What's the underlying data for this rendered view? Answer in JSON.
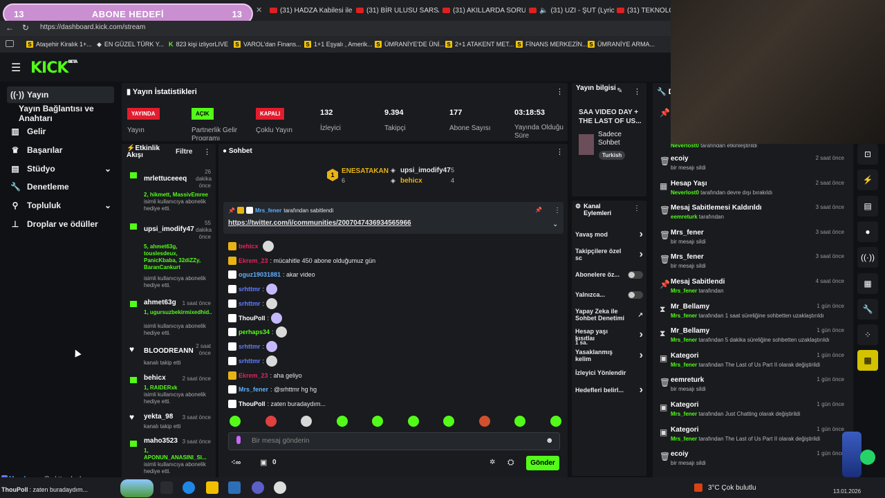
{
  "overlay": {
    "goal_left": "13",
    "goal_title": "ABONE HEDEFİ",
    "goal_right": "13"
  },
  "tabs": [
    {
      "label": "(31) HADZA Kabilesi ile H"
    },
    {
      "label": "(31) BİR ULUSU SARSAN"
    },
    {
      "label": "(31) AKILLARDA SORU İ"
    },
    {
      "label": "(31) UZI - ŞUT (Lyric"
    },
    {
      "label": "(31) TEKNOLOJİNİ"
    }
  ],
  "url": "https://dashboard.kick.com/stream",
  "bookmarks": [
    {
      "label": "Ataşehir Kiralık 1+..."
    },
    {
      "label": "EN GÜZEL TÜRK Y..."
    },
    {
      "label": "823 kişi izliyorLIVE"
    },
    {
      "label": "VAROL'dan Finans..."
    },
    {
      "label": "1+1 Eşyalı , Amerik..."
    },
    {
      "label": "ÜMRANİYE'DE ÜNİ..."
    },
    {
      "label": "2+1 ATAKENT MET..."
    },
    {
      "label": "FİNANS MERKEZİN..."
    },
    {
      "label": "ÜMRANİYE ARMA..."
    }
  ],
  "brand": {
    "logo": "KICK",
    "beta": "BETA"
  },
  "sidebar": [
    {
      "label": "Yayın",
      "icon": "broadcast-icon"
    },
    {
      "label": "Yayın Bağlantısı ve Anahtarı",
      "icon": ""
    },
    {
      "label": "Gelir",
      "icon": "chart-icon"
    },
    {
      "label": "Başarılar",
      "icon": "trophy-icon"
    },
    {
      "label": "Stüdyo",
      "icon": "studio-icon"
    },
    {
      "label": "Denetleme",
      "icon": "wrench-icon"
    },
    {
      "label": "Topluluk",
      "icon": "community-icon"
    },
    {
      "label": "Droplar ve ödüller",
      "icon": "drops-icon"
    }
  ],
  "stats": {
    "title": "Yayın İstatistikleri",
    "items": [
      {
        "badge": "YAYINDA",
        "label": "Yayın"
      },
      {
        "badge": "AÇIK",
        "label": "Partnerlik Gelir Programı"
      },
      {
        "badge": "KAPALI",
        "label": "Çoklu Yayın"
      },
      {
        "value": "132",
        "label": "İzleyici"
      },
      {
        "value": "9.394",
        "label": "Takipçi"
      },
      {
        "value": "177",
        "label": "Abone Sayısı"
      },
      {
        "value": "03:18:53",
        "label": "Yayında Olduğu Süre"
      }
    ]
  },
  "activity": {
    "title": "Etkinlik Akışı",
    "filter": "Filtre",
    "items": [
      {
        "name": "mrlettuceeeq",
        "time": "26 dakika önce",
        "green": "2, hikmett, MassivEmree",
        "desc": "isimli kullanıcıya abonelik hediye etti."
      },
      {
        "name": "upsi_imodify47",
        "time": "55 dakika önce",
        "green": "5, ahmet63g, touslesdeux, PanicKbaba, 32diZZy, BaranCankurt",
        "desc": "isimli kullanıcıya abonelik hediye etti."
      },
      {
        "name": "ahmet63g",
        "time": "1 saat önce",
        "green": "1, ugursuzbekirmixedhid...",
        "desc": "isimli kullanıcıya abonelik hediye etti."
      },
      {
        "name": "BLOODREANN",
        "time": "2 saat önce",
        "green": "",
        "desc": "kanalı takip etti"
      },
      {
        "name": "behicx",
        "time": "2 saat önce",
        "green": "1, RAIDERxk",
        "desc": "isimli kullanıcıya abonelik hediye etti."
      },
      {
        "name": "yekta_98",
        "time": "3 saat önce",
        "green": "",
        "desc": "kanalı takip etti"
      },
      {
        "name": "maho3523",
        "time": "3 saat önce",
        "green": "1, APONUN_ANASINI_SI...",
        "desc": "isimli kullanıcıya abonelik hediye etti."
      }
    ]
  },
  "chat": {
    "title": "Sohbet",
    "leaders": [
      {
        "name": "ENESATAKAN",
        "count": "6",
        "rank": "1"
      },
      {
        "name": "upsi_imodify47",
        "count": "5"
      },
      {
        "name": "behicx",
        "count": "4"
      }
    ],
    "pinned_by": "Mrs_fener",
    "pinned_suffix": "tarafından sabitlendi",
    "pinned_link": "https://twitter.com/i/communities/2007047436934565966",
    "messages": [
      {
        "user": "behicx",
        "color": "#e2245a",
        "text": ""
      },
      {
        "user": "Ekrem_23",
        "color": "#e2245a",
        "text": ": mücahitle 450 abone olduğumuz gün"
      },
      {
        "user": "oguz19031881",
        "color": "#5fb0ff",
        "text": ": akar video"
      },
      {
        "user": "srhttmr",
        "color": "#5f7bff",
        "text": ":"
      },
      {
        "user": "srhttmr",
        "color": "#5f7bff",
        "text": ":"
      },
      {
        "user": "ThouPoll",
        "color": "#ffffff",
        "text": ":"
      },
      {
        "user": "perhaps34",
        "color": "#53fc18",
        "text": ":"
      },
      {
        "user": "srhttmr",
        "color": "#5f7bff",
        "text": ":"
      },
      {
        "user": "srhttmr",
        "color": "#5f7bff",
        "text": ":"
      },
      {
        "user": "Ekrem_23",
        "color": "#e2245a",
        "text": ": aha geliyo"
      },
      {
        "user": "Mrs_fener",
        "color": "#5fb0ff",
        "text": ": @srhttmr hg hg"
      },
      {
        "user": "ThouPoll",
        "color": "#ffffff",
        "text": ": zaten buradaydım..."
      }
    ],
    "placeholder": "Bir mesaj gönderin",
    "points": "0",
    "send": "Gönder"
  },
  "stream_info": {
    "title": "Yayın bilgisi",
    "stream_title": "SAA VIDEO DAY + THE LAST OF US...",
    "category": "Sadece Sohbet",
    "language": "Turkish"
  },
  "channel_actions": {
    "title": "Kanal Eylemleri",
    "items": [
      {
        "label": "Yavaş mod",
        "type": "arrow"
      },
      {
        "label": "Takipçilere özel sc",
        "type": "arrow"
      },
      {
        "label": "Abonelere öz...",
        "type": "toggle"
      },
      {
        "label": "Yalnızca...",
        "type": "toggle"
      },
      {
        "label": "Yapay Zeka ile Sohbet Denetimi",
        "type": "link"
      },
      {
        "label": "Hesap yaşı kısıtlaı",
        "sub": "1 sa.",
        "type": "arrow"
      },
      {
        "label": "Yasaklanmış kelim",
        "type": "arrow"
      },
      {
        "label": "İzleyici Yönlendir",
        "type": "none"
      },
      {
        "label": "Hedefleri belirl...",
        "type": "arrow"
      }
    ]
  },
  "modlog": {
    "title": "De",
    "items": [
      {
        "icon": "pin-icon",
        "title": "",
        "sub_green": "Neverlost0",
        "sub": "tarafından etkinleştirildi",
        "time": ""
      },
      {
        "icon": "trash-icon",
        "title": "ecoiy",
        "sub_green": "",
        "sub": "bir mesajı sildi",
        "time": "2 saat önce"
      },
      {
        "icon": "calendar-icon",
        "title": "Hesap Yaşı",
        "sub_green": "Neverlost0",
        "sub": "tarafından devre dışı bırakıldı",
        "time": "2 saat önce"
      },
      {
        "icon": "trash-icon",
        "title": "Mesaj Sabitlemesi Kaldırıldı",
        "sub_green": "eemreturk",
        "sub": "tarafından",
        "time": "3 saat önce"
      },
      {
        "icon": "trash-icon",
        "title": "Mrs_fener",
        "sub_green": "",
        "sub": "bir mesajı sildi",
        "time": "3 saat önce"
      },
      {
        "icon": "trash-icon",
        "title": "Mrs_fener",
        "sub_green": "",
        "sub": "bir mesajı sildi",
        "time": "3 saat önce"
      },
      {
        "icon": "pin-icon",
        "title": "Mesaj Sabitlendi",
        "sub_green": "Mrs_fener",
        "sub": "tarafından",
        "time": "4 saat önce"
      },
      {
        "icon": "hourglass-icon",
        "title": "Mr_Bellamy",
        "sub_green": "Mrs_fener",
        "sub": "tarafından 1 saat süreliğine sohbetten uzaklaştırıldı",
        "time": "1 gün önce"
      },
      {
        "icon": "hourglass-icon",
        "title": "Mr_Bellamy",
        "sub_green": "Mrs_fener",
        "sub": "tarafından 5 dakika süreliğine sohbetten uzaklaştırıldı",
        "time": "1 gün önce"
      },
      {
        "icon": "category-icon",
        "title": "Kategori",
        "sub_green": "Mrs_fener",
        "sub": "tarafından The Last of Us Part II olarak değiştirildi",
        "time": "1 gün önce"
      },
      {
        "icon": "trash-icon",
        "title": "eemreturk",
        "sub_green": "",
        "sub": "bir mesajı sildi",
        "time": "1 gün önce"
      },
      {
        "icon": "category-icon",
        "title": "Kategori",
        "sub_green": "Mrs_fener",
        "sub": "tarafından Just Chatting olarak değiştirildi",
        "time": "1 gün önce"
      },
      {
        "icon": "category-icon",
        "title": "Kategori",
        "sub_green": "Mrs_fener",
        "sub": "tarafından The Last of Us Part II olarak değiştirildi",
        "time": "1 gün önce"
      },
      {
        "icon": "trash-icon",
        "title": "ecoiy",
        "sub_green": "",
        "sub": "bir mesajı sildi",
        "time": "1 gün önce"
      }
    ]
  },
  "overlay_chat": [
    {
      "user": "Mrs_fener",
      "text": ": @srhttmr hg hg"
    },
    {
      "user": "ThouPoll",
      "text": ": zaten buradaydım..."
    }
  ],
  "taskbar": {
    "weather": "3°C  Çok bulutlu",
    "date": "13.01.2026"
  }
}
